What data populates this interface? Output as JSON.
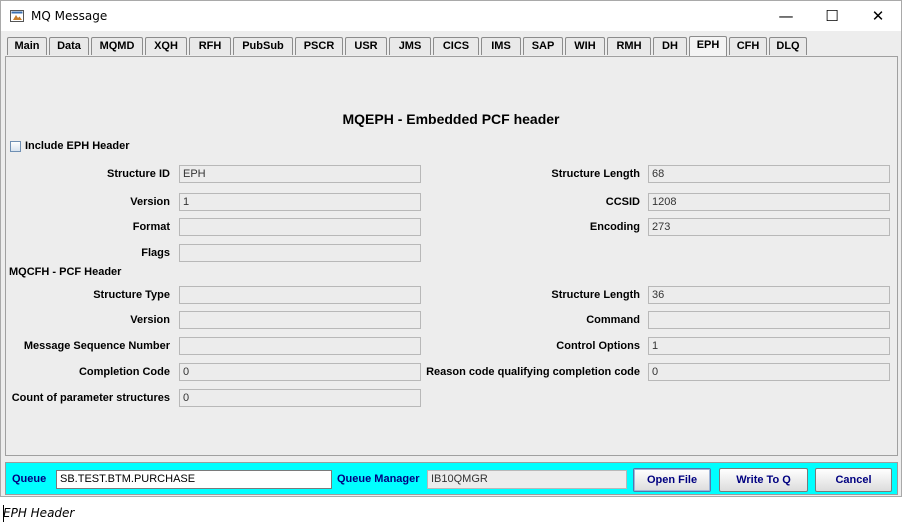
{
  "window": {
    "title": "MQ Message",
    "icon": "app-icon",
    "controls": {
      "minimize": "—",
      "maximize": "☐",
      "close": "✕"
    }
  },
  "tabs": [
    {
      "label": "Main"
    },
    {
      "label": "Data"
    },
    {
      "label": "MQMD"
    },
    {
      "label": "XQH"
    },
    {
      "label": "RFH"
    },
    {
      "label": "PubSub"
    },
    {
      "label": "PSCR"
    },
    {
      "label": "USR"
    },
    {
      "label": "JMS"
    },
    {
      "label": "CICS"
    },
    {
      "label": "IMS"
    },
    {
      "label": "SAP"
    },
    {
      "label": "WIH"
    },
    {
      "label": "RMH"
    },
    {
      "label": "DH"
    },
    {
      "label": "EPH"
    },
    {
      "label": "CFH"
    },
    {
      "label": "DLQ"
    }
  ],
  "active_tab": "EPH",
  "panel": {
    "title": "MQEPH - Embedded PCF header",
    "include_label": "Include EPH Header",
    "include_checked": false,
    "eph_left": [
      {
        "label": "Structure ID",
        "value": "EPH"
      },
      {
        "label": "Version",
        "value": "1"
      },
      {
        "label": "Format",
        "value": ""
      },
      {
        "label": "Flags",
        "value": ""
      }
    ],
    "eph_right": [
      {
        "label": "Structure Length",
        "value": "68"
      },
      {
        "label": "CCSID",
        "value": "1208"
      },
      {
        "label": "Encoding",
        "value": "273"
      }
    ],
    "cfh_section": "MQCFH - PCF Header",
    "cfh_left": [
      {
        "label": "Structure Type",
        "value": ""
      },
      {
        "label": "Version",
        "value": ""
      },
      {
        "label": "Message Sequence Number",
        "value": ""
      },
      {
        "label": "Completion Code",
        "value": "0"
      },
      {
        "label": "Count of parameter structures",
        "value": "0"
      }
    ],
    "cfh_right": [
      {
        "label": "Structure Length",
        "value": "36"
      },
      {
        "label": "Command",
        "value": ""
      },
      {
        "label": "Control Options",
        "value": "1"
      },
      {
        "label": "Reason code qualifying completion code",
        "value": "0"
      }
    ]
  },
  "bottom": {
    "queue_label": "Queue",
    "queue_value": "SB.TEST.BTM.PURCHASE",
    "qmgr_label": "Queue Manager",
    "qmgr_value": "IB10QMGR",
    "open_file": "Open File",
    "write_to_q": "Write To Q",
    "cancel": "Cancel"
  },
  "caption": "EPH Header",
  "colors": {
    "bottom_bar": "#00ffff",
    "button_text": "#000080"
  }
}
